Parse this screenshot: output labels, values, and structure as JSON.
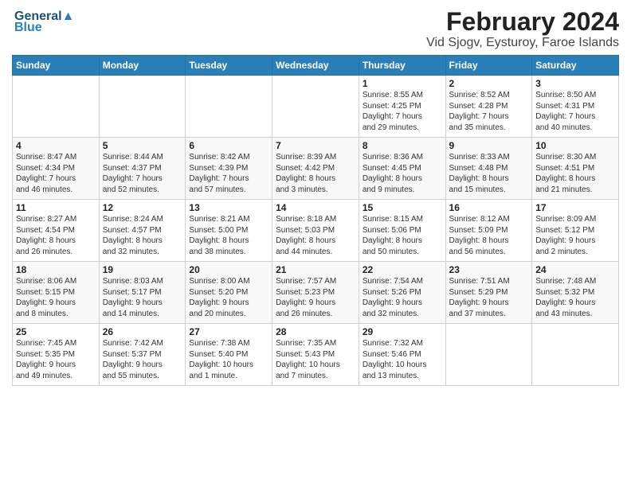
{
  "logo": {
    "line1": "General",
    "line2": "Blue"
  },
  "header": {
    "month": "February 2024",
    "location": "Vid Sjogv, Eysturoy, Faroe Islands"
  },
  "weekdays": [
    "Sunday",
    "Monday",
    "Tuesday",
    "Wednesday",
    "Thursday",
    "Friday",
    "Saturday"
  ],
  "weeks": [
    [
      {
        "day": "",
        "text": ""
      },
      {
        "day": "",
        "text": ""
      },
      {
        "day": "",
        "text": ""
      },
      {
        "day": "",
        "text": ""
      },
      {
        "day": "1",
        "text": "Sunrise: 8:55 AM\nSunset: 4:25 PM\nDaylight: 7 hours\nand 29 minutes."
      },
      {
        "day": "2",
        "text": "Sunrise: 8:52 AM\nSunset: 4:28 PM\nDaylight: 7 hours\nand 35 minutes."
      },
      {
        "day": "3",
        "text": "Sunrise: 8:50 AM\nSunset: 4:31 PM\nDaylight: 7 hours\nand 40 minutes."
      }
    ],
    [
      {
        "day": "4",
        "text": "Sunrise: 8:47 AM\nSunset: 4:34 PM\nDaylight: 7 hours\nand 46 minutes."
      },
      {
        "day": "5",
        "text": "Sunrise: 8:44 AM\nSunset: 4:37 PM\nDaylight: 7 hours\nand 52 minutes."
      },
      {
        "day": "6",
        "text": "Sunrise: 8:42 AM\nSunset: 4:39 PM\nDaylight: 7 hours\nand 57 minutes."
      },
      {
        "day": "7",
        "text": "Sunrise: 8:39 AM\nSunset: 4:42 PM\nDaylight: 8 hours\nand 3 minutes."
      },
      {
        "day": "8",
        "text": "Sunrise: 8:36 AM\nSunset: 4:45 PM\nDaylight: 8 hours\nand 9 minutes."
      },
      {
        "day": "9",
        "text": "Sunrise: 8:33 AM\nSunset: 4:48 PM\nDaylight: 8 hours\nand 15 minutes."
      },
      {
        "day": "10",
        "text": "Sunrise: 8:30 AM\nSunset: 4:51 PM\nDaylight: 8 hours\nand 21 minutes."
      }
    ],
    [
      {
        "day": "11",
        "text": "Sunrise: 8:27 AM\nSunset: 4:54 PM\nDaylight: 8 hours\nand 26 minutes."
      },
      {
        "day": "12",
        "text": "Sunrise: 8:24 AM\nSunset: 4:57 PM\nDaylight: 8 hours\nand 32 minutes."
      },
      {
        "day": "13",
        "text": "Sunrise: 8:21 AM\nSunset: 5:00 PM\nDaylight: 8 hours\nand 38 minutes."
      },
      {
        "day": "14",
        "text": "Sunrise: 8:18 AM\nSunset: 5:03 PM\nDaylight: 8 hours\nand 44 minutes."
      },
      {
        "day": "15",
        "text": "Sunrise: 8:15 AM\nSunset: 5:06 PM\nDaylight: 8 hours\nand 50 minutes."
      },
      {
        "day": "16",
        "text": "Sunrise: 8:12 AM\nSunset: 5:09 PM\nDaylight: 8 hours\nand 56 minutes."
      },
      {
        "day": "17",
        "text": "Sunrise: 8:09 AM\nSunset: 5:12 PM\nDaylight: 9 hours\nand 2 minutes."
      }
    ],
    [
      {
        "day": "18",
        "text": "Sunrise: 8:06 AM\nSunset: 5:15 PM\nDaylight: 9 hours\nand 8 minutes."
      },
      {
        "day": "19",
        "text": "Sunrise: 8:03 AM\nSunset: 5:17 PM\nDaylight: 9 hours\nand 14 minutes."
      },
      {
        "day": "20",
        "text": "Sunrise: 8:00 AM\nSunset: 5:20 PM\nDaylight: 9 hours\nand 20 minutes."
      },
      {
        "day": "21",
        "text": "Sunrise: 7:57 AM\nSunset: 5:23 PM\nDaylight: 9 hours\nand 26 minutes."
      },
      {
        "day": "22",
        "text": "Sunrise: 7:54 AM\nSunset: 5:26 PM\nDaylight: 9 hours\nand 32 minutes."
      },
      {
        "day": "23",
        "text": "Sunrise: 7:51 AM\nSunset: 5:29 PM\nDaylight: 9 hours\nand 37 minutes."
      },
      {
        "day": "24",
        "text": "Sunrise: 7:48 AM\nSunset: 5:32 PM\nDaylight: 9 hours\nand 43 minutes."
      }
    ],
    [
      {
        "day": "25",
        "text": "Sunrise: 7:45 AM\nSunset: 5:35 PM\nDaylight: 9 hours\nand 49 minutes."
      },
      {
        "day": "26",
        "text": "Sunrise: 7:42 AM\nSunset: 5:37 PM\nDaylight: 9 hours\nand 55 minutes."
      },
      {
        "day": "27",
        "text": "Sunrise: 7:38 AM\nSunset: 5:40 PM\nDaylight: 10 hours\nand 1 minute."
      },
      {
        "day": "28",
        "text": "Sunrise: 7:35 AM\nSunset: 5:43 PM\nDaylight: 10 hours\nand 7 minutes."
      },
      {
        "day": "29",
        "text": "Sunrise: 7:32 AM\nSunset: 5:46 PM\nDaylight: 10 hours\nand 13 minutes."
      },
      {
        "day": "",
        "text": ""
      },
      {
        "day": "",
        "text": ""
      }
    ]
  ]
}
